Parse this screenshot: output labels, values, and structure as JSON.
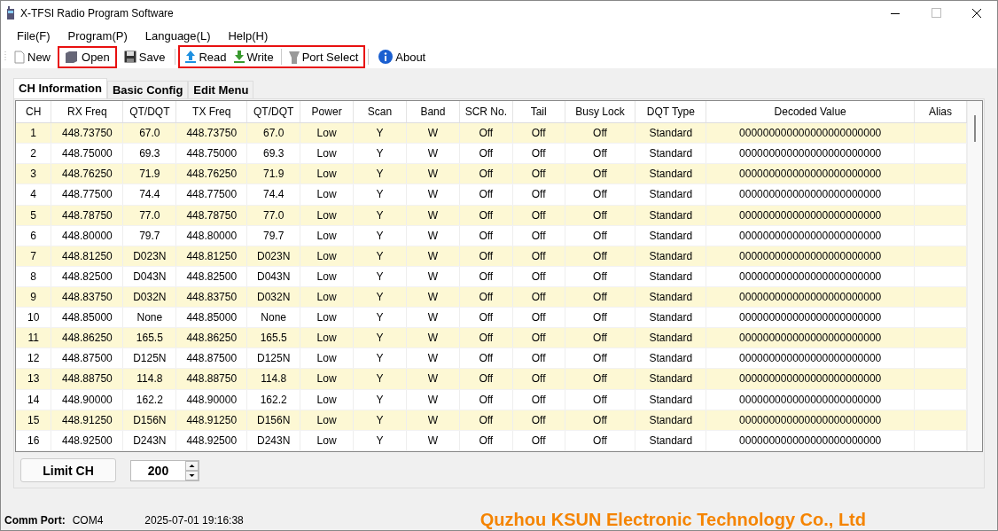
{
  "window": {
    "title": "X-TFSI Radio Program Software"
  },
  "menu": [
    "File(F)",
    "Program(P)",
    "Language(L)",
    "Help(H)"
  ],
  "toolbar": [
    {
      "highlighted": false,
      "items": [
        {
          "kind": "new",
          "label": "New"
        }
      ]
    },
    {
      "highlighted": true,
      "items": [
        {
          "kind": "open",
          "label": "Open"
        }
      ]
    },
    {
      "highlighted": false,
      "items": [
        {
          "kind": "save",
          "label": "Save"
        }
      ]
    },
    {
      "highlighted": true,
      "items": [
        {
          "kind": "read",
          "label": "Read"
        },
        {
          "kind": "write",
          "label": "Write"
        },
        {
          "kind": "port",
          "label": "Port Select"
        }
      ]
    },
    {
      "highlighted": false,
      "items": [
        {
          "kind": "about",
          "label": "About"
        }
      ]
    }
  ],
  "tabs": [
    {
      "label": "CH Information",
      "selected": true
    },
    {
      "label": "Basic Config",
      "selected": false
    },
    {
      "label": "Edit Menu",
      "selected": false
    }
  ],
  "table": {
    "columns": [
      "CH",
      "RX Freq",
      "QT/DQT",
      "TX Freq",
      "QT/DQT",
      "Power",
      "Scan",
      "Band",
      "SCR No.",
      "Tail",
      "Busy Lock",
      "DQT Type",
      "Decoded Value",
      "Alias"
    ],
    "rows": [
      [
        "1",
        "448.73750",
        "67.0",
        "448.73750",
        "67.0",
        "Low",
        "Y",
        "W",
        "Off",
        "Off",
        "Off",
        "Standard",
        "000000000000000000000000"
      ],
      [
        "2",
        "448.75000",
        "69.3",
        "448.75000",
        "69.3",
        "Low",
        "Y",
        "W",
        "Off",
        "Off",
        "Off",
        "Standard",
        "000000000000000000000000"
      ],
      [
        "3",
        "448.76250",
        "71.9",
        "448.76250",
        "71.9",
        "Low",
        "Y",
        "W",
        "Off",
        "Off",
        "Off",
        "Standard",
        "000000000000000000000000"
      ],
      [
        "4",
        "448.77500",
        "74.4",
        "448.77500",
        "74.4",
        "Low",
        "Y",
        "W",
        "Off",
        "Off",
        "Off",
        "Standard",
        "000000000000000000000000"
      ],
      [
        "5",
        "448.78750",
        "77.0",
        "448.78750",
        "77.0",
        "Low",
        "Y",
        "W",
        "Off",
        "Off",
        "Off",
        "Standard",
        "000000000000000000000000"
      ],
      [
        "6",
        "448.80000",
        "79.7",
        "448.80000",
        "79.7",
        "Low",
        "Y",
        "W",
        "Off",
        "Off",
        "Off",
        "Standard",
        "000000000000000000000000"
      ],
      [
        "7",
        "448.81250",
        "D023N",
        "448.81250",
        "D023N",
        "Low",
        "Y",
        "W",
        "Off",
        "Off",
        "Off",
        "Standard",
        "000000000000000000000000"
      ],
      [
        "8",
        "448.82500",
        "D043N",
        "448.82500",
        "D043N",
        "Low",
        "Y",
        "W",
        "Off",
        "Off",
        "Off",
        "Standard",
        "000000000000000000000000"
      ],
      [
        "9",
        "448.83750",
        "D032N",
        "448.83750",
        "D032N",
        "Low",
        "Y",
        "W",
        "Off",
        "Off",
        "Off",
        "Standard",
        "000000000000000000000000"
      ],
      [
        "10",
        "448.85000",
        "None",
        "448.85000",
        "None",
        "Low",
        "Y",
        "W",
        "Off",
        "Off",
        "Off",
        "Standard",
        "000000000000000000000000"
      ],
      [
        "11",
        "448.86250",
        "165.5",
        "448.86250",
        "165.5",
        "Low",
        "Y",
        "W",
        "Off",
        "Off",
        "Off",
        "Standard",
        "000000000000000000000000"
      ],
      [
        "12",
        "448.87500",
        "D125N",
        "448.87500",
        "D125N",
        "Low",
        "Y",
        "W",
        "Off",
        "Off",
        "Off",
        "Standard",
        "000000000000000000000000"
      ],
      [
        "13",
        "448.88750",
        "114.8",
        "448.88750",
        "114.8",
        "Low",
        "Y",
        "W",
        "Off",
        "Off",
        "Off",
        "Standard",
        "000000000000000000000000"
      ],
      [
        "14",
        "448.90000",
        "162.2",
        "448.90000",
        "162.2",
        "Low",
        "Y",
        "W",
        "Off",
        "Off",
        "Off",
        "Standard",
        "000000000000000000000000"
      ],
      [
        "15",
        "448.91250",
        "D156N",
        "448.91250",
        "D156N",
        "Low",
        "Y",
        "W",
        "Off",
        "Off",
        "Off",
        "Standard",
        "000000000000000000000000"
      ],
      [
        "16",
        "448.92500",
        "D243N",
        "448.92500",
        "D243N",
        "Low",
        "Y",
        "W",
        "Off",
        "Off",
        "Off",
        "Standard",
        "000000000000000000000000"
      ]
    ]
  },
  "limit": {
    "button": "Limit CH",
    "value": "200"
  },
  "status_bar": {
    "port_label": "Comm Port:",
    "port": "COM4",
    "datetime": "2025-07-01 19:16:38",
    "company": "Quzhou KSUN Electronic Technology Co., Ltd"
  }
}
